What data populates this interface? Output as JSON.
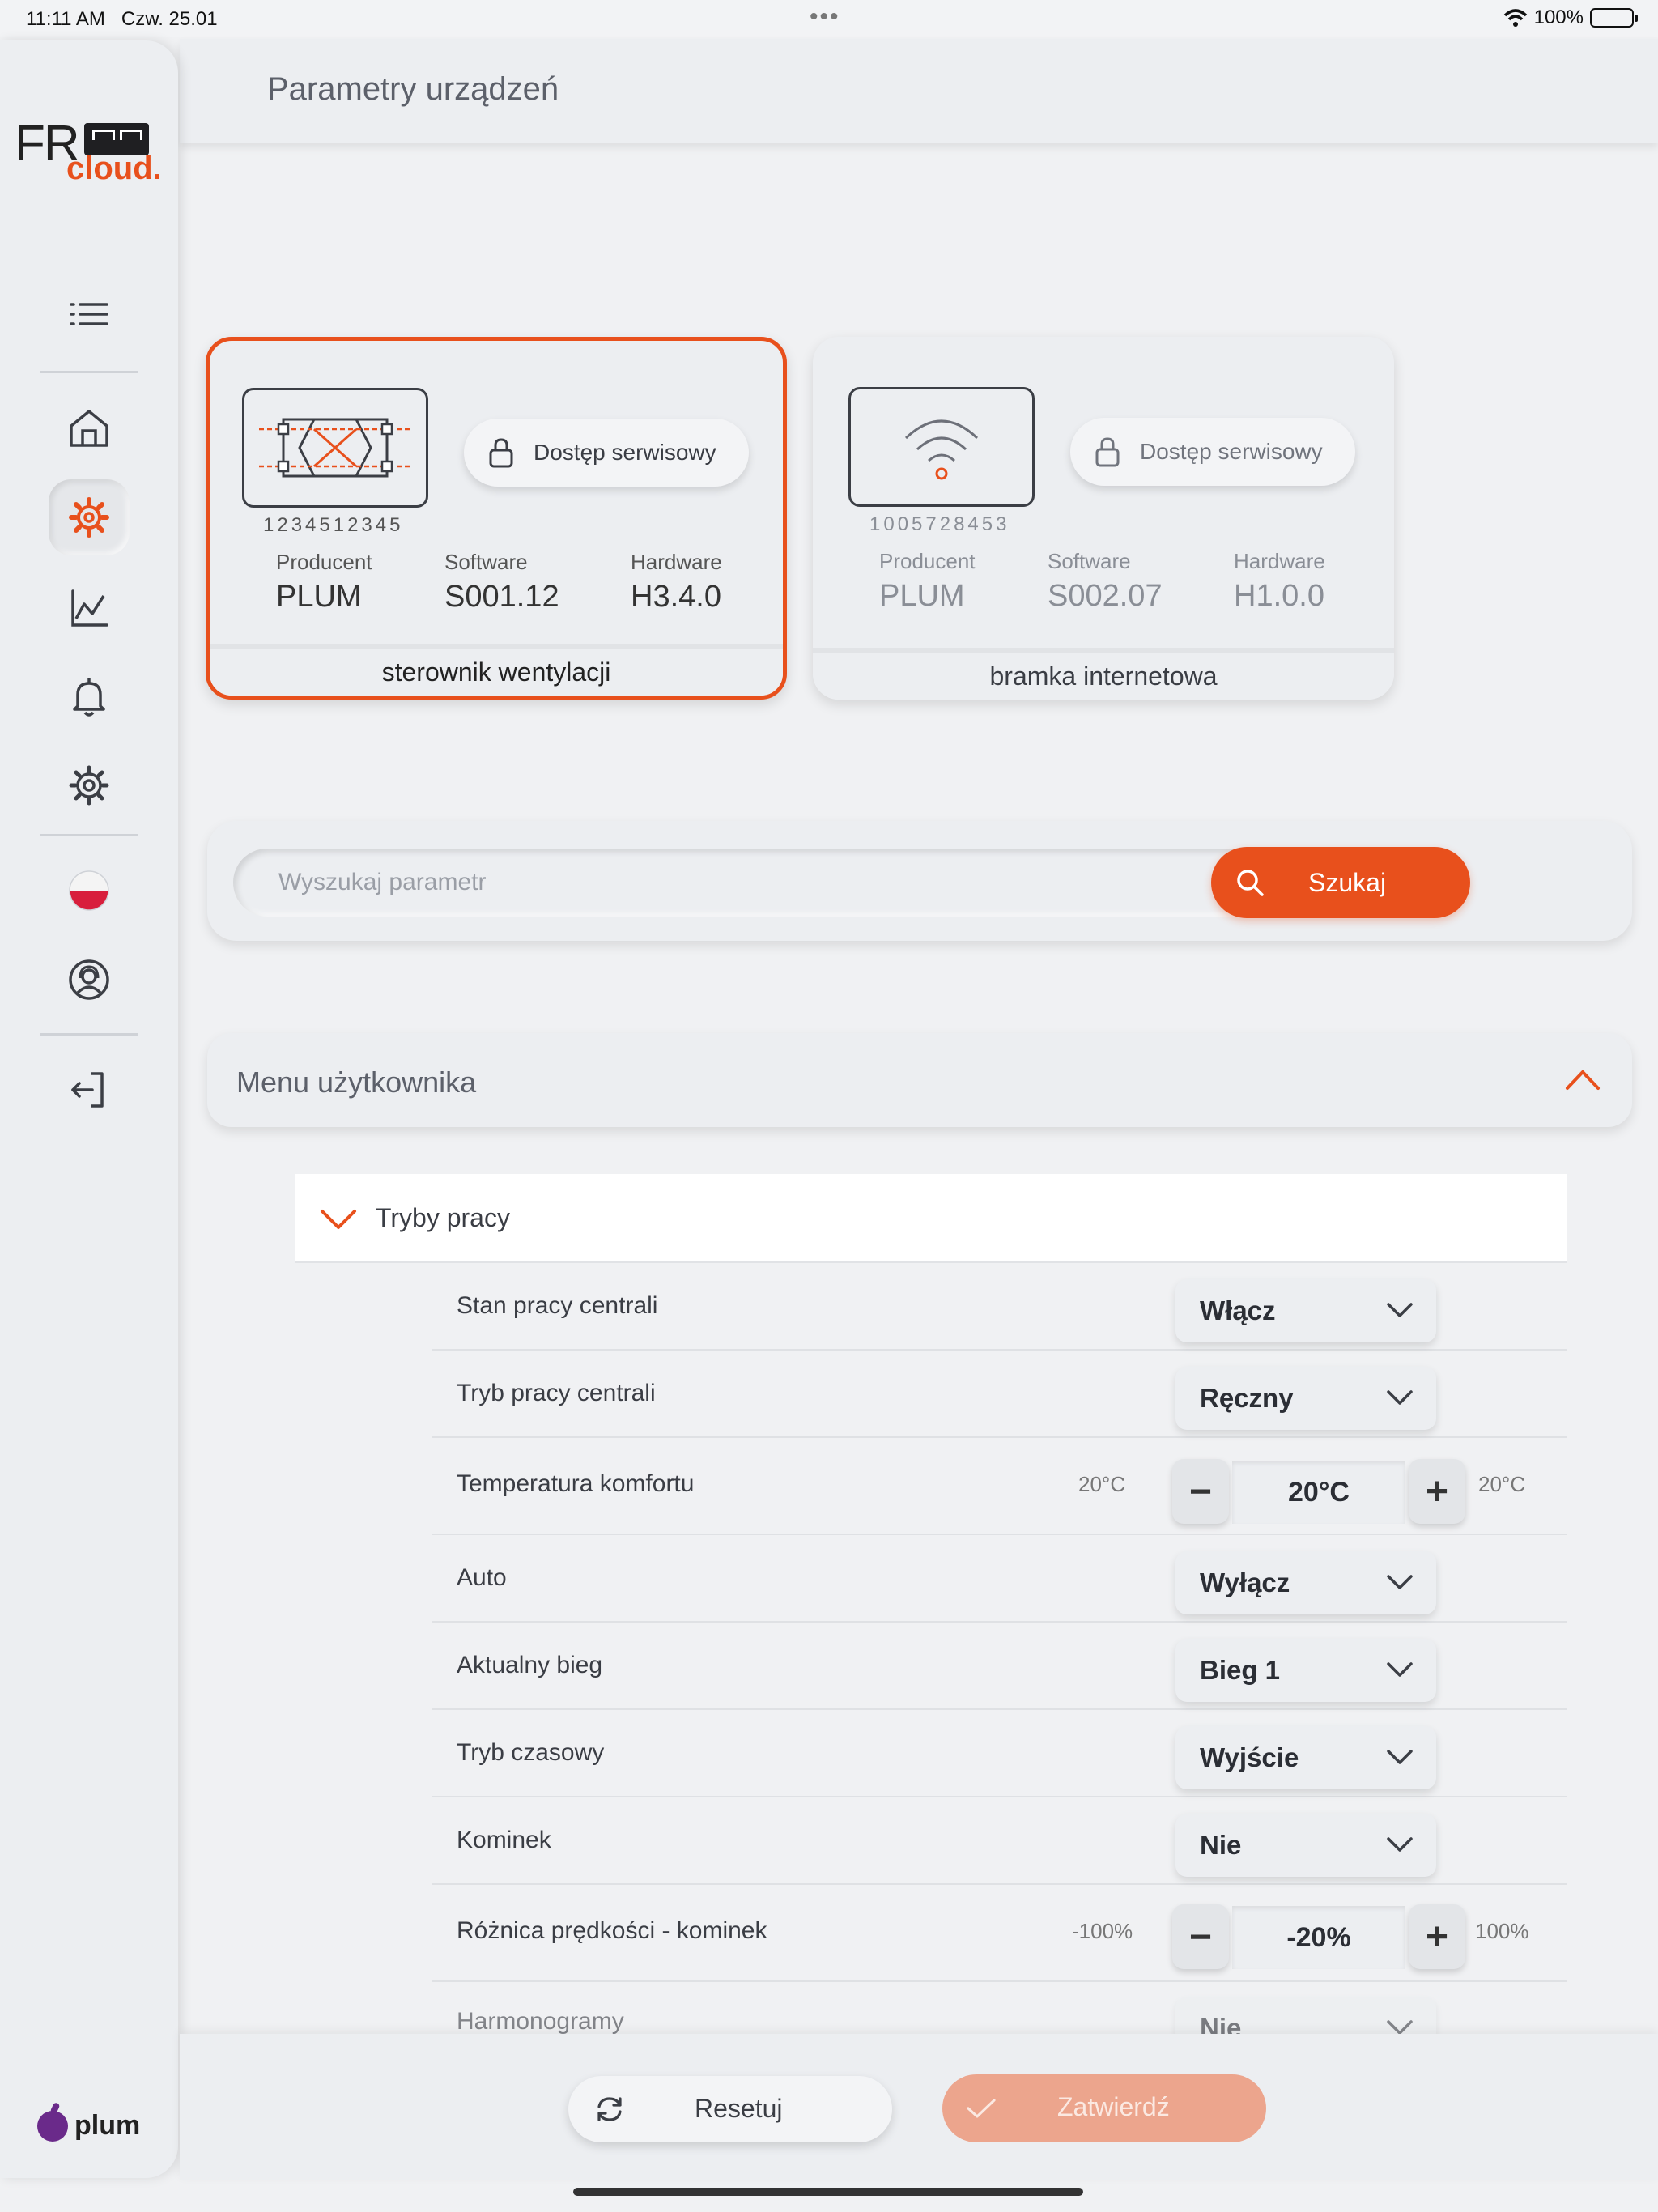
{
  "statusbar": {
    "time": "11:11 AM",
    "date": "Czw. 25.01",
    "battery": "100%",
    "dots": "•••"
  },
  "brand": {
    "logo_text_1": "FR",
    "logo_text_2": "cloud.",
    "vendor": "plum"
  },
  "header": {
    "title": "Parametry urządzeń"
  },
  "sidebar": {
    "items": [
      {
        "icon": "menu-list-icon"
      },
      {
        "icon": "home-icon"
      },
      {
        "icon": "device-settings-icon",
        "active": true
      },
      {
        "icon": "chart-icon"
      },
      {
        "icon": "bell-icon"
      },
      {
        "icon": "gear-icon"
      },
      {
        "icon": "flag-pl-icon"
      },
      {
        "icon": "support-agent-icon"
      },
      {
        "icon": "logout-icon"
      }
    ]
  },
  "devices": [
    {
      "serial": "1234512345",
      "service_label": "Dostęp serwisowy",
      "producer_label": "Producent",
      "producer": "PLUM",
      "software_label": "Software",
      "software": "S001.12",
      "hardware_label": "Hardware",
      "hardware": "H3.4.0",
      "name": "sterownik wentylacji",
      "selected": true
    },
    {
      "serial": "1005728453",
      "service_label": "Dostęp serwisowy",
      "producer_label": "Producent",
      "producer": "PLUM",
      "software_label": "Software",
      "software": "S002.07",
      "hardware_label": "Hardware",
      "hardware": "H1.0.0",
      "name": "bramka internetowa",
      "selected": false
    }
  ],
  "search": {
    "placeholder": "Wyszukaj parametr",
    "button": "Szukaj"
  },
  "menu": {
    "title": "Menu użytkownika"
  },
  "group": {
    "title": "Tryby pracy"
  },
  "params": [
    {
      "label": "Stan pracy centrali",
      "type": "select",
      "value": "Włącz"
    },
    {
      "label": "Tryb pracy centrali",
      "type": "select",
      "value": "Ręczny"
    },
    {
      "label": "Temperatura komfortu",
      "type": "stepper",
      "value": "20°C",
      "min": "20°C",
      "max": "20°C"
    },
    {
      "label": "Auto",
      "type": "select",
      "value": "Wyłącz"
    },
    {
      "label": "Aktualny bieg",
      "type": "select",
      "value": "Bieg 1"
    },
    {
      "label": "Tryb czasowy",
      "type": "select",
      "value": "Wyjście"
    },
    {
      "label": "Kominek",
      "type": "select",
      "value": "Nie"
    },
    {
      "label": "Różnica prędkości - kominek",
      "type": "stepper",
      "value": "-20%",
      "min": "-100%",
      "max": "100%"
    },
    {
      "label": "Harmonogramy",
      "type": "select",
      "value": "Nie"
    }
  ],
  "actions": {
    "reset": "Resetuj",
    "confirm": "Zatwierdź"
  },
  "colors": {
    "accent": "#e8501c",
    "confirm_disabled": "#eca58d",
    "background": "#f0f1f3"
  }
}
